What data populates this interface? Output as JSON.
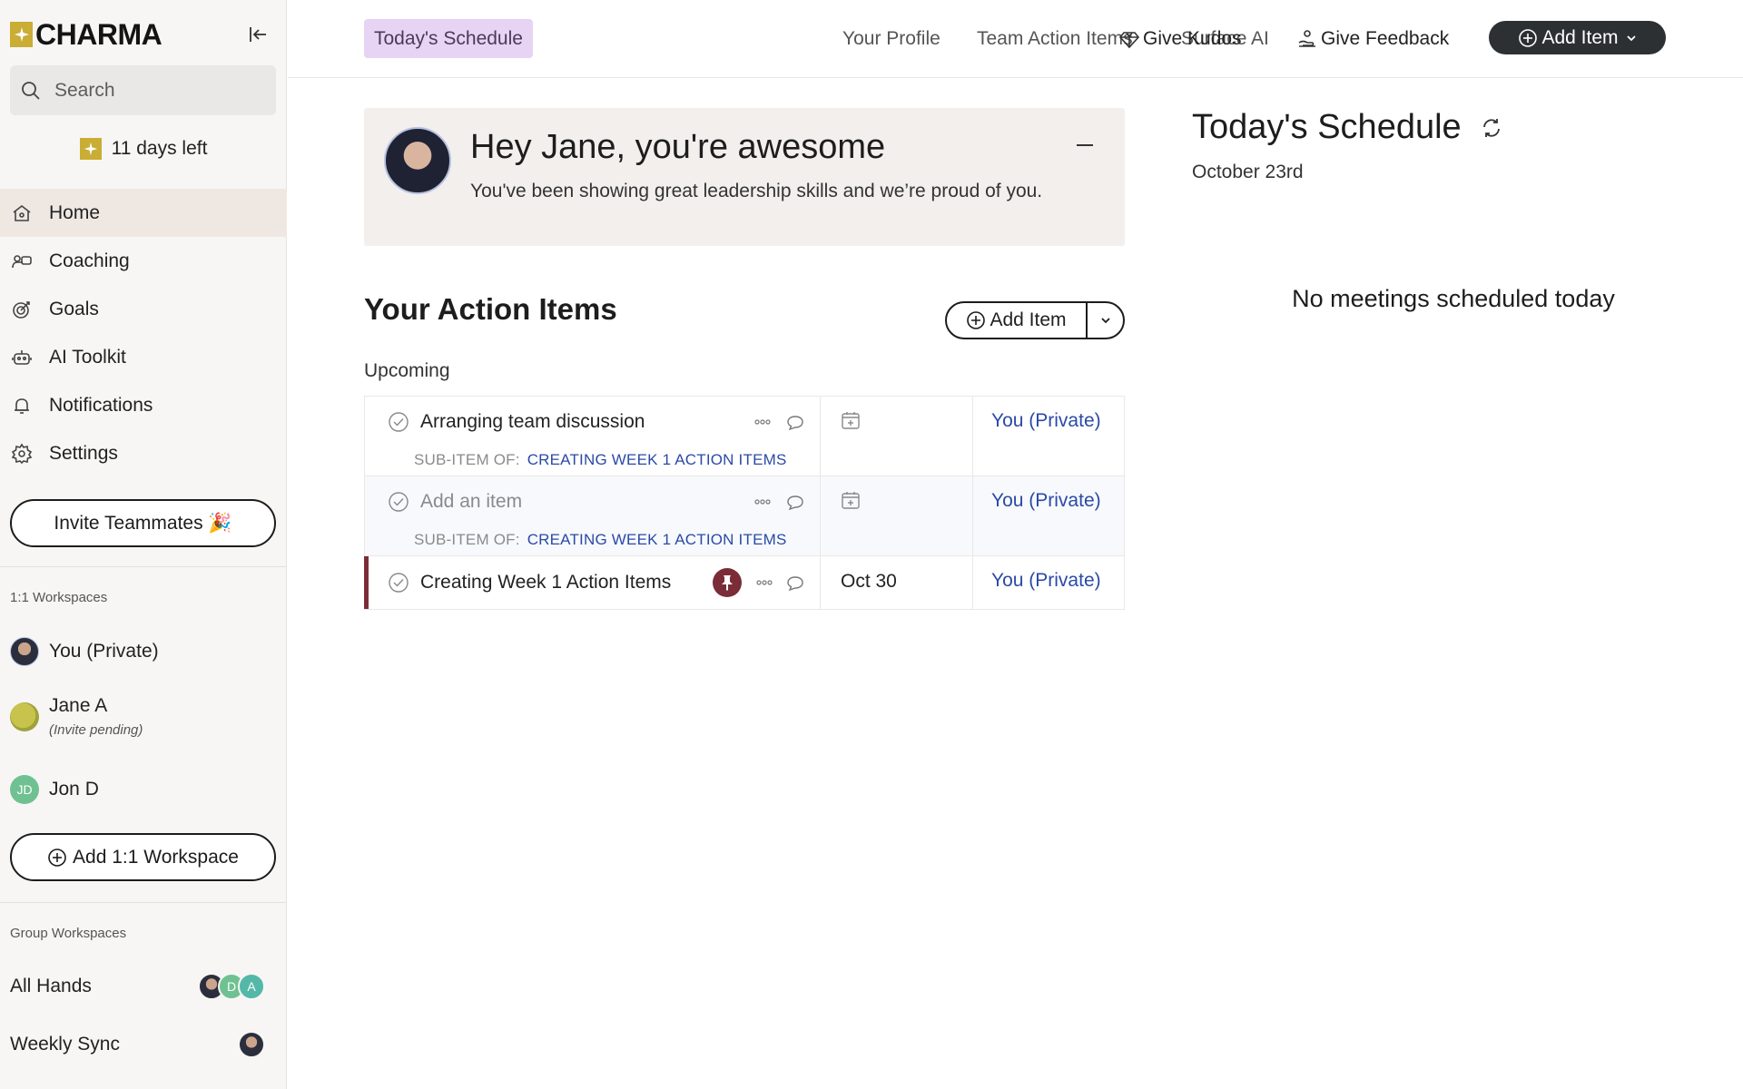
{
  "app": {
    "name": "CHARMA"
  },
  "sidebar": {
    "search_placeholder": "Search",
    "trial_text": "11 days left",
    "nav": [
      {
        "label": "Home",
        "icon": "home-icon",
        "active": true
      },
      {
        "label": "Coaching",
        "icon": "coaching-icon"
      },
      {
        "label": "Goals",
        "icon": "target-icon"
      },
      {
        "label": "AI Toolkit",
        "icon": "robot-icon"
      },
      {
        "label": "Notifications",
        "icon": "bell-icon"
      },
      {
        "label": "Settings",
        "icon": "gear-icon"
      }
    ],
    "invite_label": "Invite Teammates 🎉",
    "one_on_one_label": "1:1 Workspaces",
    "one_on_one": [
      {
        "name": "You (Private)"
      },
      {
        "name": "Jane A",
        "sub": "(Invite pending)"
      },
      {
        "name": "Jon D",
        "initials": "JD"
      }
    ],
    "add_workspace_label": "Add 1:1 Workspace",
    "group_label": "Group Workspaces",
    "groups": [
      {
        "name": "All Hands",
        "initials": [
          "D",
          "A"
        ]
      },
      {
        "name": "Weekly Sync"
      }
    ]
  },
  "topnav": {
    "tabs": [
      {
        "label": "Today's Schedule",
        "active": true
      },
      {
        "label": "Your Profile"
      },
      {
        "label": "Team Action Items"
      },
      {
        "label": "Surface AI"
      }
    ],
    "kudos_label": "Give Kudos",
    "feedback_label": "Give Feedback",
    "add_item_label": "Add Item"
  },
  "banner": {
    "title": "Hey Jane, you're awesome",
    "text": "You've been showing great leadership skills and we’re proud of you."
  },
  "action_items": {
    "title": "Your Action Items",
    "add_label": "Add Item",
    "section": "Upcoming",
    "sub_label": "SUB-ITEM OF:",
    "rows": [
      {
        "title": "Arranging team discussion",
        "parent": "CREATING WEEK 1 ACTION ITEMS",
        "owner": "You (Private)"
      },
      {
        "title": "Add an item",
        "parent": "CREATING WEEK 1 ACTION ITEMS",
        "owner": "You (Private)"
      },
      {
        "title": "Creating Week 1 Action Items",
        "date": "Oct 30",
        "owner": "You (Private)"
      }
    ]
  },
  "schedule": {
    "title": "Today's Schedule",
    "date": "October 23rd",
    "empty": "No meetings scheduled today"
  },
  "colors": {
    "brand": "#c9ad34",
    "active_tab": "#e7d3f3",
    "link": "#2b4aa6",
    "accent": "#7a2d37",
    "dark_button": "#2d3033"
  }
}
